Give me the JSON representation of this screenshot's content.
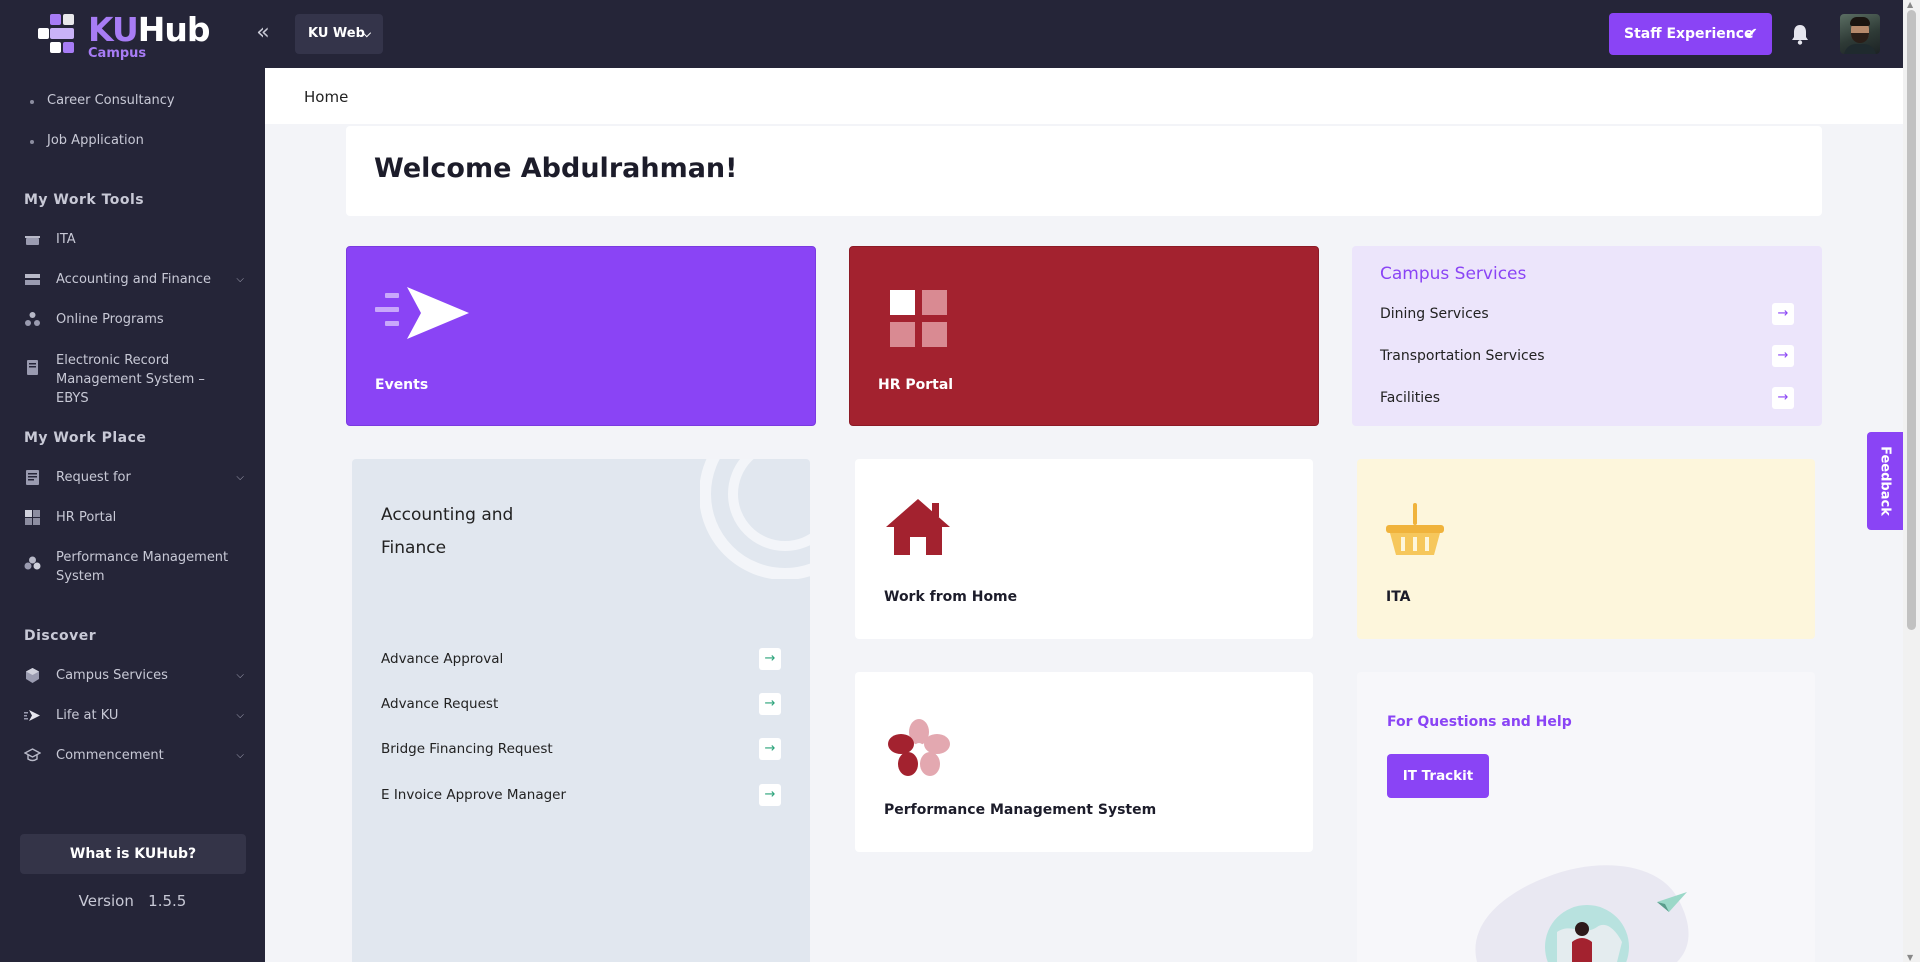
{
  "header": {
    "logo_ku": "KU",
    "logo_hub": "Hub",
    "logo_sub": "Campus",
    "web_selector": "KU Web",
    "staff_button": "Staff Experience"
  },
  "sidebar": {
    "sub_items": [
      "Career Consultancy",
      "Job Application"
    ],
    "sections": [
      {
        "heading": "My Work Tools",
        "items": [
          {
            "label": "ITA"
          },
          {
            "label": "Accounting and Finance"
          },
          {
            "label": "Online Programs"
          },
          {
            "label": "Electronic Record Management System – EBYS"
          }
        ]
      },
      {
        "heading": "My Work Place",
        "items": [
          {
            "label": "Request for"
          },
          {
            "label": "HR Portal"
          },
          {
            "label": "Performance Management System"
          }
        ]
      },
      {
        "heading": "Discover",
        "items": [
          {
            "label": "Campus Services"
          },
          {
            "label": "Life at KU"
          },
          {
            "label": "Commencement"
          }
        ]
      }
    ],
    "what_button": "What is KUHub?",
    "version_label": "Version",
    "version_number": "1.5.5"
  },
  "breadcrumb": "Home",
  "welcome": "Welcome Abdulrahman!",
  "tiles": {
    "events": "Events",
    "hr_portal": "HR Portal",
    "campus_services": {
      "title": "Campus Services",
      "links": [
        "Dining Services",
        "Transportation Services",
        "Facilities"
      ]
    },
    "accounting": {
      "title": "Accounting and Finance",
      "links": [
        "Advance Approval",
        "Advance Request",
        "Bridge Financing Request",
        "E Invoice Approve Manager"
      ]
    },
    "work_from_home": "Work from Home",
    "ita": "ITA",
    "performance": "Performance Management System",
    "help": {
      "title": "For Questions and Help",
      "button": "IT Trackit"
    }
  },
  "feedback": "Feedback",
  "colors": {
    "topbar": "#252538",
    "accent": "#8a44f5",
    "hr_red": "#a3222f",
    "campus_bg": "#ece5fb",
    "accounting_bg": "#e1e7ef",
    "ita_bg": "#fdf6dc"
  }
}
